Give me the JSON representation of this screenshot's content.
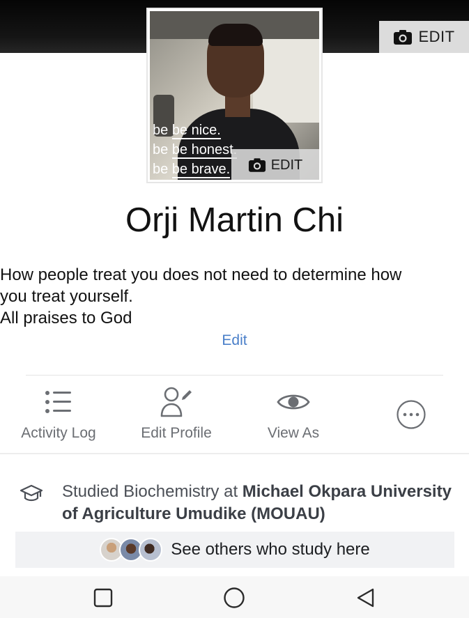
{
  "cover": {
    "edit_label": "EDIT"
  },
  "profile_photo": {
    "overlay_lines": [
      "be nice.",
      "be honest.",
      "be brave."
    ],
    "edit_label": "EDIT"
  },
  "profile": {
    "name": "Orji Martin Chi",
    "bio_lines": [
      "How people treat you does not need to determine how",
      "you treat yourself.",
      "All praises to God"
    ],
    "bio_edit_label": "Edit"
  },
  "actions": [
    {
      "label": "Activity Log",
      "icon": "list-icon"
    },
    {
      "label": "Edit Profile",
      "icon": "edit-profile-icon"
    },
    {
      "label": "View As",
      "icon": "eye-icon"
    },
    {
      "label": "",
      "icon": "more-icon"
    }
  ],
  "education": {
    "prefix": "Studied Biochemistry at ",
    "school": "Michael Okpara University of Agriculture Umudike (MOUAU)",
    "icon": "graduation-cap-icon"
  },
  "others": {
    "label": "See others who study here"
  },
  "nav": {
    "items": [
      "recents-square-icon",
      "home-circle-icon",
      "back-triangle-icon"
    ]
  },
  "colors": {
    "link_blue": "#4a7fc9",
    "action_gray": "#6b6e73",
    "cover_dark": "#0a0a0a"
  }
}
